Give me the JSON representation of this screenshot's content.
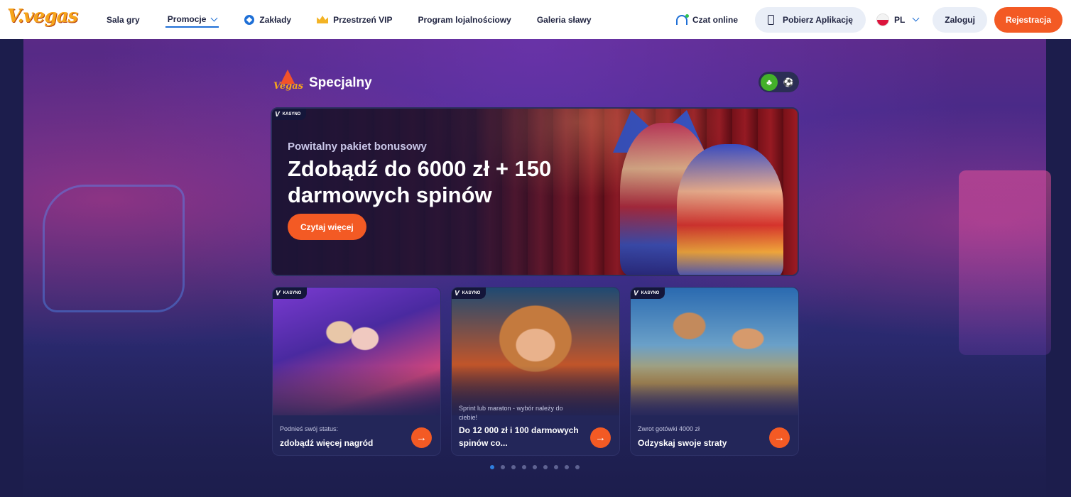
{
  "header": {
    "logo_text": "V.vegas",
    "nav": [
      {
        "label": "Sala gry"
      },
      {
        "label": "Promocje"
      },
      {
        "label": "Zakłady"
      },
      {
        "label": "Przestrzeń VIP"
      },
      {
        "label": "Program lojalnościowy"
      },
      {
        "label": "Galeria sławy"
      }
    ],
    "chat_label": "Czat online",
    "app_button": "Pobierz Aplikację",
    "language": "PL",
    "login": "Zaloguj",
    "register": "Rejestracja"
  },
  "section": {
    "logo_text": "Vegas",
    "title": "Specjalny",
    "toggle": {
      "active": "casino-icon",
      "inactive": "football-icon"
    }
  },
  "hero": {
    "tag": "KASYNO",
    "subtitle": "Powitalny pakiet bonusowy",
    "title": "Zdobądź do 6000 zł + 150 darmowych spinów",
    "button": "Czytaj więcej"
  },
  "cards": [
    {
      "tag": "KASYNO",
      "kicker": "Podnieś swój status:",
      "title": "zdobądź więcej nagród"
    },
    {
      "tag": "KASYNO",
      "kicker": "Sprint lub maraton - wybór należy do ciebie!",
      "title": "Do 12 000 zł i 100 darmowych spinów co..."
    },
    {
      "tag": "KASYNO",
      "kicker": "Zwrot gotówki 4000 zł",
      "title": "Odzyskaj swoje straty"
    }
  ],
  "pagination": {
    "total": 9,
    "active_index": 0
  },
  "colors": {
    "accent": "#f35a24",
    "brand_blue": "#1e6fd6",
    "background": "#1c1d4c"
  }
}
